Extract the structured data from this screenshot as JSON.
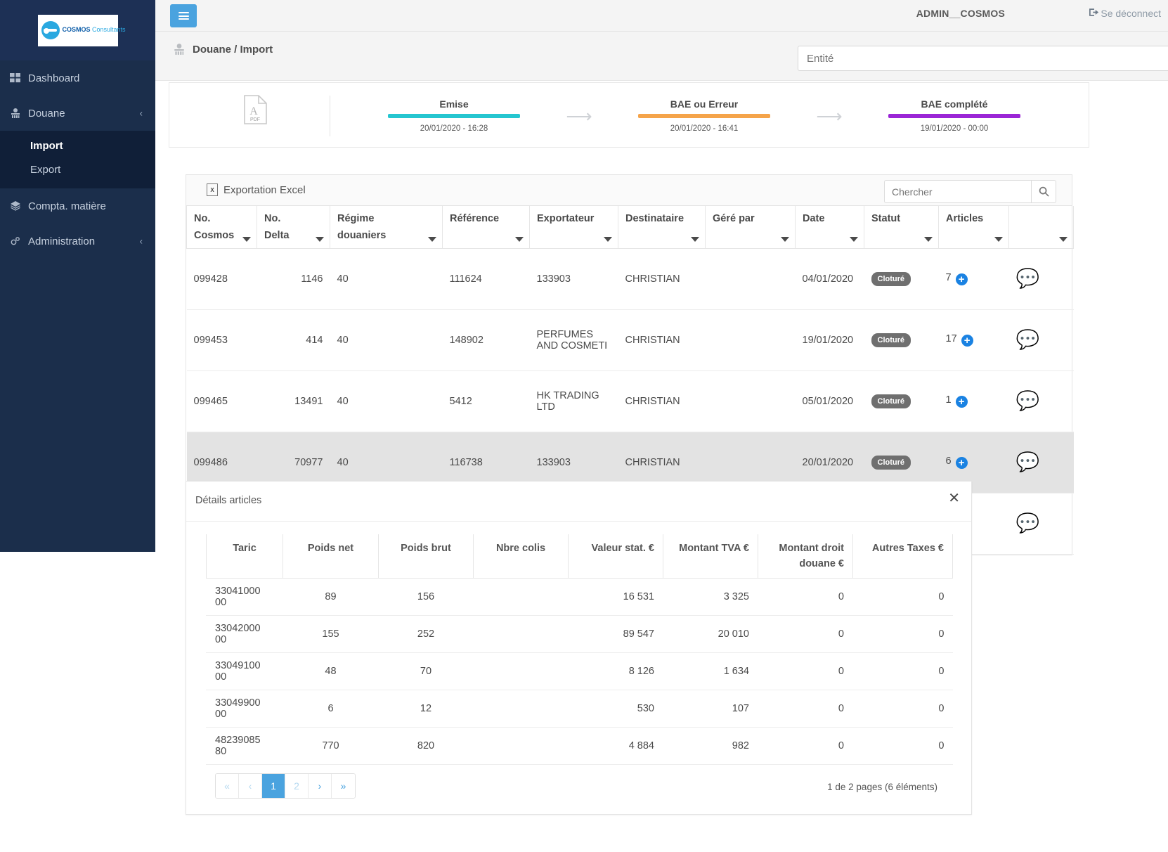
{
  "sidebar": {
    "logo": {
      "brand": "COSMOS",
      "suffix": "Consultants"
    },
    "items": [
      {
        "label": "Dashboard",
        "icon": "grid-icon",
        "chevron": ""
      },
      {
        "label": "Douane",
        "icon": "officer-icon",
        "chevron": "‹"
      },
      {
        "label": "Compta. matière",
        "icon": "layers-icon",
        "chevron": ""
      },
      {
        "label": "Administration",
        "icon": "gears-icon",
        "chevron": "‹"
      }
    ],
    "sub_items": [
      {
        "label": "Import"
      },
      {
        "label": "Export"
      }
    ]
  },
  "topbar": {
    "menu_icon": "hamburger-icon",
    "user": "ADMIN__COSMOS",
    "logout": "Se déconnect",
    "logout_icon": "sign-out-icon"
  },
  "breadcrumb": {
    "icon": "officer-icon",
    "text": "Douane / Import",
    "entity_placeholder": "Entité",
    "entity_value": ""
  },
  "status_panel": {
    "pdf_icon": "pdf-file-icon",
    "arrow": "⟶",
    "steps": [
      {
        "label": "Emise",
        "date": "20/01/2020 - 16:28",
        "color": "#25c6d0"
      },
      {
        "label": "BAE ou Erreur",
        "date": "20/01/2020 - 16:41",
        "color": "#f5a44a"
      },
      {
        "label": "BAE complété",
        "date": "19/01/2020 - 00:00",
        "color": "#9b25d6"
      }
    ]
  },
  "toolbar": {
    "export_label": "Exportation Excel",
    "export_icon": "excel-icon",
    "search_placeholder": "Chercher",
    "search_value": "",
    "search_icon": "search-icon"
  },
  "grid": {
    "columns": [
      {
        "l1": "No.",
        "l2": "Cosmos",
        "caret": true
      },
      {
        "l1": "No.",
        "l2": "Delta",
        "caret": true
      },
      {
        "l1": "Régime",
        "l2": "douaniers",
        "caret": true
      },
      {
        "l1": "Référence",
        "l2": "",
        "caret": true
      },
      {
        "l1": "Exportateur",
        "l2": "",
        "caret": true
      },
      {
        "l1": "Destinataire",
        "l2": "",
        "caret": true
      },
      {
        "l1": "Géré par",
        "l2": "",
        "caret": true
      },
      {
        "l1": "Date",
        "l2": "",
        "caret": true
      },
      {
        "l1": "Statut",
        "l2": "",
        "caret": true
      },
      {
        "l1": "Articles",
        "l2": "",
        "caret": true
      },
      {
        "l1": "",
        "l2": "",
        "caret": true
      }
    ],
    "rows": [
      {
        "no_cosmos": "099428",
        "no_delta": "1146",
        "regime": "40",
        "reference": "111624",
        "exportateur": "133903",
        "destinataire": "CHRISTIAN",
        "gere_par": "",
        "date": "04/01/2020",
        "statut": "Cloturé",
        "articles": "7",
        "selected": false
      },
      {
        "no_cosmos": "099453",
        "no_delta": "414",
        "regime": "40",
        "reference": "148902",
        "exportateur": "PERFUMES AND COSMETI",
        "destinataire": "CHRISTIAN",
        "gere_par": "",
        "date": "19/01/2020",
        "statut": "Cloturé",
        "articles": "17",
        "selected": false
      },
      {
        "no_cosmos": "099465",
        "no_delta": "13491",
        "regime": "40",
        "reference": "5412",
        "exportateur": "HK TRADING LTD",
        "destinataire": "CHRISTIAN",
        "gere_par": "",
        "date": "05/01/2020",
        "statut": "Cloturé",
        "articles": "1",
        "selected": false
      },
      {
        "no_cosmos": "099486",
        "no_delta": "70977",
        "regime": "40",
        "reference": "116738",
        "exportateur": "133903",
        "destinataire": "CHRISTIAN",
        "gere_par": "",
        "date": "20/01/2020",
        "statut": "Cloturé",
        "articles": "6",
        "selected": true
      }
    ]
  },
  "details": {
    "title": "Détails articles",
    "close_icon": "close-icon",
    "columns": [
      {
        "l1": "Taric",
        "l2": ""
      },
      {
        "l1": "Poids net",
        "l2": ""
      },
      {
        "l1": "Poids brut",
        "l2": ""
      },
      {
        "l1": "Nbre colis",
        "l2": ""
      },
      {
        "l1": "Valeur stat. €",
        "l2": ""
      },
      {
        "l1": "Montant TVA €",
        "l2": ""
      },
      {
        "l1": "Montant droit",
        "l2": "douane €"
      },
      {
        "l1": "Autres Taxes €",
        "l2": ""
      }
    ],
    "rows": [
      {
        "taric": "33041000 00",
        "poids_net": "89",
        "poids_brut": "156",
        "nbre_colis": "",
        "valeur_stat": "16 531",
        "montant_tva": "3 325",
        "montant_droit": "0",
        "autres_taxes": "0"
      },
      {
        "taric": "33042000 00",
        "poids_net": "155",
        "poids_brut": "252",
        "nbre_colis": "",
        "valeur_stat": "89 547",
        "montant_tva": "20 010",
        "montant_droit": "0",
        "autres_taxes": "0"
      },
      {
        "taric": "33049100 00",
        "poids_net": "48",
        "poids_brut": "70",
        "nbre_colis": "",
        "valeur_stat": "8 126",
        "montant_tva": "1 634",
        "montant_droit": "0",
        "autres_taxes": "0"
      },
      {
        "taric": "33049900 00",
        "poids_net": "6",
        "poids_brut": "12",
        "nbre_colis": "",
        "valeur_stat": "530",
        "montant_tva": "107",
        "montant_droit": "0",
        "autres_taxes": "0"
      },
      {
        "taric": "48239085 80",
        "poids_net": "770",
        "poids_brut": "820",
        "nbre_colis": "",
        "valeur_stat": "4 884",
        "montant_tva": "982",
        "montant_droit": "0",
        "autres_taxes": "0"
      }
    ],
    "pagination": {
      "first": "«",
      "prev": "‹",
      "next": "›",
      "last": "»",
      "pages": [
        "1",
        "2"
      ],
      "active_page": "1",
      "info": "1 de 2 pages (6 éléments)"
    }
  },
  "colors": {
    "sidebar_bg": "#1b2e4b",
    "sidebar_sub_bg": "#101f38",
    "accent_blue": "#4aa3df",
    "badge_gray": "#6f6f6f",
    "plus_blue": "#1a82e2"
  }
}
